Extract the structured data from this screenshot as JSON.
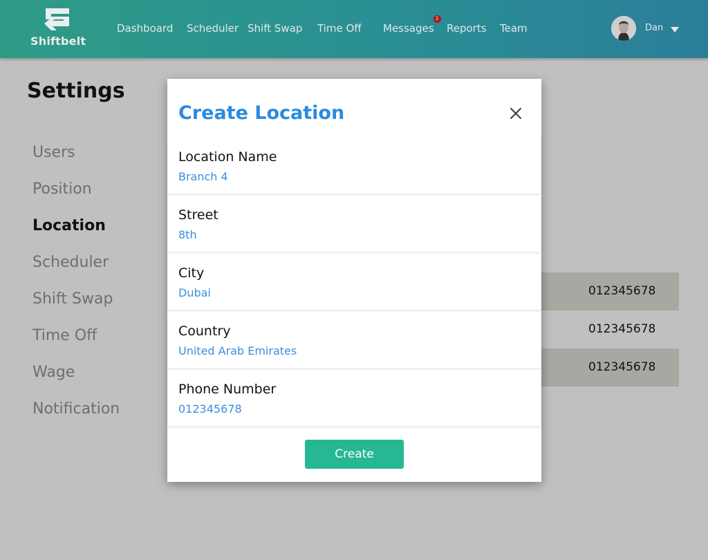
{
  "app": {
    "name": "Shiftbelt"
  },
  "nav": {
    "items": [
      "Dashboard",
      "Scheduler",
      "Shift Swap",
      "Time Off",
      "Messages",
      "Reports",
      "Team"
    ],
    "messages_badge": "2"
  },
  "user": {
    "name": "Dan"
  },
  "settings": {
    "title": "Settings",
    "sidebar": [
      "Users",
      "Position",
      "Location",
      "Scheduler",
      "Shift Swap",
      "Time Off",
      "Wage",
      "Notification"
    ],
    "active": "Location",
    "phones": [
      "012345678",
      "012345678",
      "012345678"
    ]
  },
  "modal": {
    "title": "Create Location",
    "fields": [
      {
        "label": "Location Name",
        "value": "Branch 4"
      },
      {
        "label": "Street",
        "value": "8th"
      },
      {
        "label": "City",
        "value": "Dubai"
      },
      {
        "label": "Country",
        "value": "United Arab Emirates"
      },
      {
        "label": "Phone Number",
        "value": "012345678"
      }
    ],
    "create_label": "Create"
  },
  "colors": {
    "header_start": "#2f9b86",
    "header_end": "#2b7e9a",
    "accent_blue": "#2a8be0",
    "create_green": "#26b893",
    "badge_red": "#b3131b"
  },
  "icons": [
    "logo-icon",
    "close-icon",
    "chevron-down-icon",
    "avatar"
  ]
}
